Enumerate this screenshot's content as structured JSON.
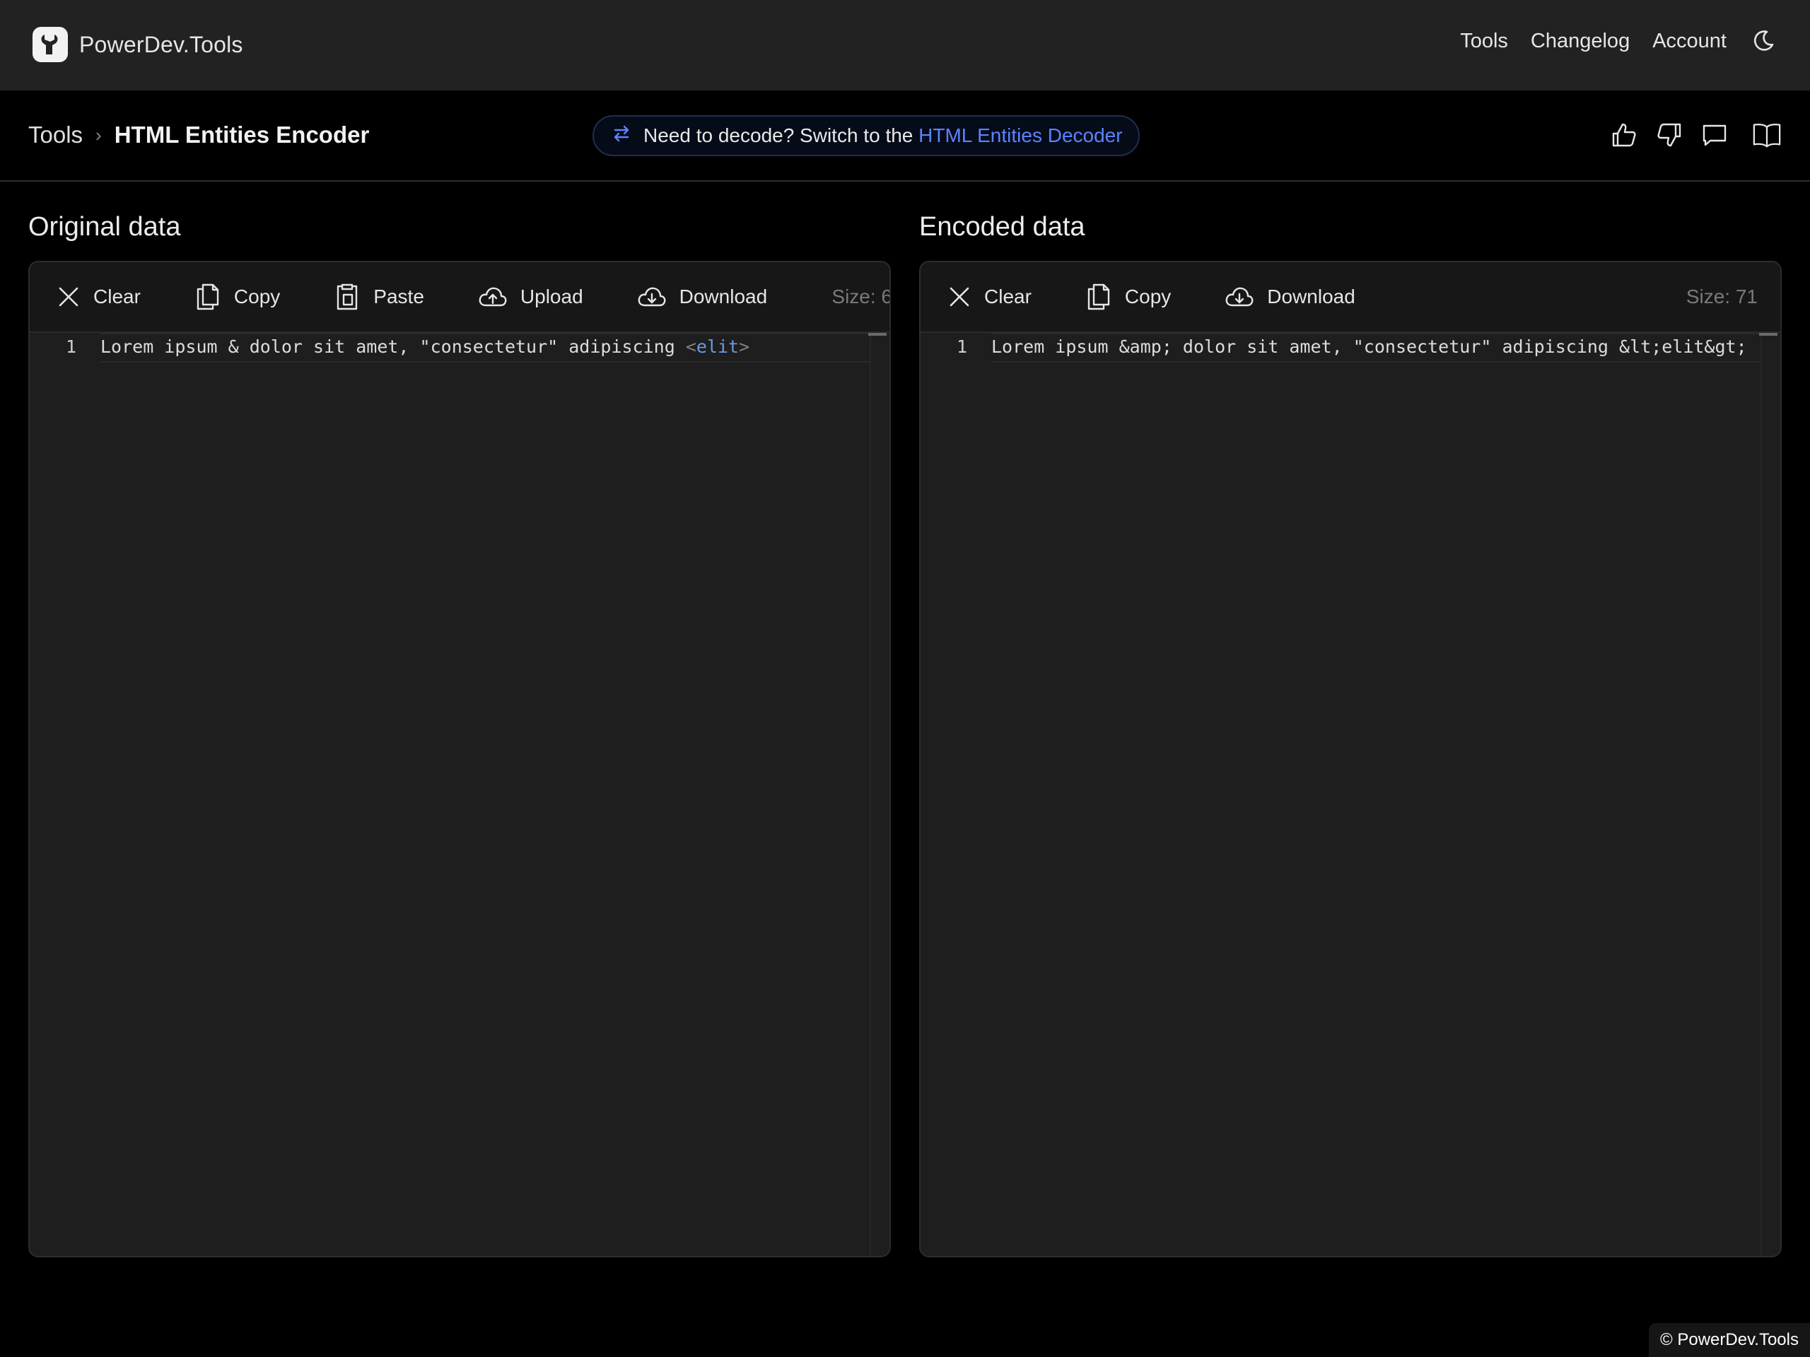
{
  "brand": {
    "name": "PowerDev.Tools",
    "logo_icon": "wrench-logo-icon"
  },
  "nav": {
    "tools": "Tools",
    "changelog": "Changelog",
    "account": "Account",
    "theme_icon": "moon-icon"
  },
  "breadcrumb": {
    "root": "Tools",
    "separator": "›",
    "current": "HTML Entities Encoder"
  },
  "switch_notice": {
    "text": "Need to decode? Switch to the",
    "link": "HTML Entities Decoder"
  },
  "actions": [
    "thumbs-up-icon",
    "thumbs-down-icon",
    "comment-icon",
    "book-icon"
  ],
  "original": {
    "title": "Original data",
    "toolbar": {
      "clear": "Clear",
      "copy": "Copy",
      "paste": "Paste",
      "upload": "Upload",
      "download": "Download",
      "size": "Size: 6"
    },
    "line_number": "1",
    "text_before": "Lorem ipsum & dolor sit amet, \"consectetur\" adipiscing ",
    "tag_open": "<",
    "tag_name": "elit",
    "tag_close": ">"
  },
  "encoded": {
    "title": "Encoded data",
    "toolbar": {
      "clear": "Clear",
      "copy": "Copy",
      "download": "Download",
      "size": "Size: 71"
    },
    "line_number": "1",
    "text": "Lorem ipsum &amp; dolor sit amet, \"consectetur\" adipiscing &lt;elit&gt;"
  },
  "footer": {
    "copyright": "© PowerDev.Tools"
  },
  "colors": {
    "link": "#5b83ff",
    "tag": "#6a9be0"
  }
}
